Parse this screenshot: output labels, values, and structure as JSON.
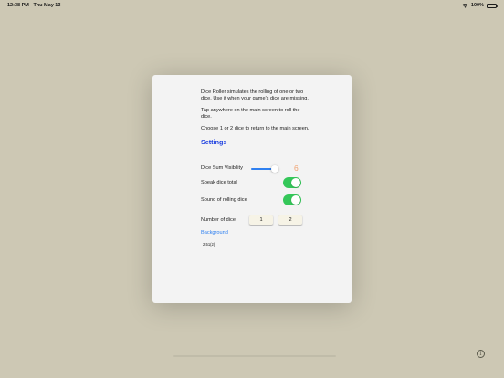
{
  "status_bar": {
    "time": "12:38 PM",
    "date": "Thu May 13",
    "battery_text": "100%",
    "wifi_icon": "wifi-icon",
    "battery_icon": "battery-full-icon"
  },
  "about": {
    "paragraphs": [
      "Dice Roller simulates the rolling of one or two dice. Use it when your game's dice are missing.",
      "Tap anywhere on the main screen to roll the dice.",
      "Choose 1 or 2 dice to return to the main screen."
    ]
  },
  "settings": {
    "heading": "Settings",
    "dice_sum_visibility": {
      "label": "Dice Sum Visibility",
      "value_text": "6",
      "slider_fraction": 0.85
    },
    "speak_dice_total": {
      "label": "Speak dice total",
      "on": true
    },
    "sound_rolling_dice": {
      "label": "Sound of rolling dice",
      "on": true
    },
    "number_of_dice": {
      "label": "Number of dice",
      "options": [
        "1",
        "2"
      ]
    },
    "background_link": "Background",
    "version": "2.51(2)"
  },
  "colors": {
    "background": "#cdc8b4",
    "accent_blue": "#1c3fe0",
    "link_blue": "#2f80f0",
    "toggle_green": "#34c759",
    "slider_value_orange": "#f0a372"
  },
  "info_icon": "info-circle-icon"
}
